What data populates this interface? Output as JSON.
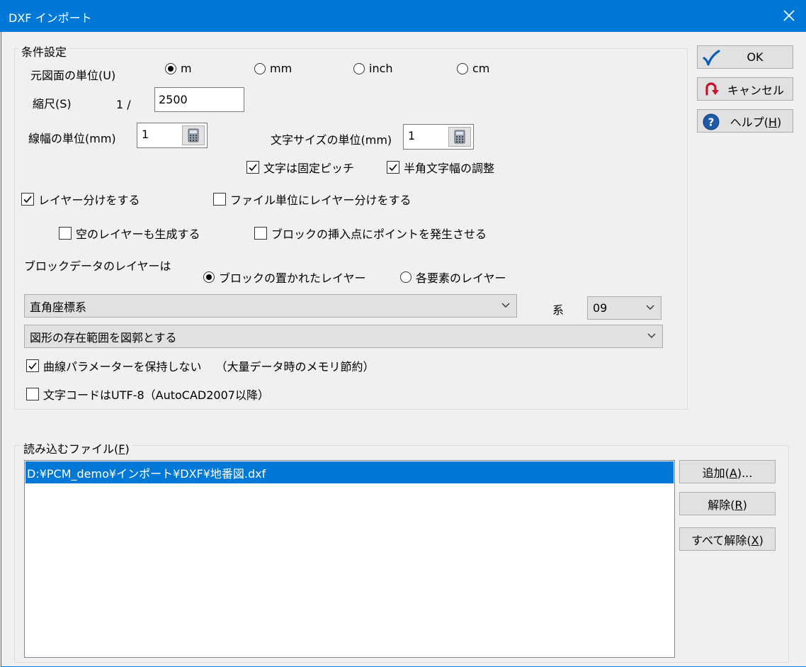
{
  "window": {
    "title": "DXF インポート"
  },
  "conditions": {
    "group_label": "条件設定",
    "unit_label": "元図面の単位(U)",
    "units": [
      {
        "label": "m",
        "selected": true
      },
      {
        "label": "mm",
        "selected": false
      },
      {
        "label": "inch",
        "selected": false
      },
      {
        "label": "cm",
        "selected": false
      }
    ],
    "scale_label": "縮尺(S)",
    "scale_prefix": "1 /",
    "scale_value": "2500",
    "line_width_label": "線幅の単位(mm)",
    "line_width_value": "1",
    "text_size_label": "文字サイズの単位(mm)",
    "text_size_value": "1",
    "fixed_pitch": {
      "label": "文字は固定ピッチ",
      "checked": true
    },
    "half_width_adjust": {
      "label": "半角文字幅の調整",
      "checked": true
    },
    "split_layers": {
      "label": "レイヤー分けをする",
      "checked": true
    },
    "split_by_file": {
      "label": "ファイル単位にレイヤー分けをする",
      "checked": false
    },
    "create_empty_layers": {
      "label": "空のレイヤーも生成する",
      "checked": false
    },
    "block_insert_points": {
      "label": "ブロックの挿入点にポイントを発生させる",
      "checked": false
    },
    "block_layer_label": "ブロックデータのレイヤーは",
    "block_layer_options": [
      {
        "label": "ブロックの置かれたレイヤー",
        "selected": true
      },
      {
        "label": "各要素のレイヤー",
        "selected": false
      }
    ],
    "coord_system": "直角座標系",
    "system_label": "系",
    "system_value": "09",
    "range_option": "図形の存在範囲を図郭とする",
    "no_curve_params": {
      "label": "曲線パラメーターを保持しない",
      "note": "（大量データ時のメモリ節約）",
      "checked": true
    },
    "utf8": {
      "label": "文字コードはUTF-8（AutoCAD2007以降）",
      "checked": false
    }
  },
  "buttons": {
    "ok": "OK",
    "cancel": "キャンセル",
    "help_text": "ヘルプ(",
    "help_key": "H",
    "help_end": ")"
  },
  "files": {
    "label_text": "読み込むファイル(",
    "label_key": "F",
    "label_end": ")",
    "items": [
      "D:¥PCM_demo¥インポート¥DXF¥地番図.dxf"
    ],
    "add_text": "追加(",
    "add_key": "A",
    "add_end": ")...",
    "remove_text": "解除(",
    "remove_key": "R",
    "remove_end": ")",
    "remove_all_text": "すべて解除(",
    "remove_all_key": "X",
    "remove_all_end": ")"
  },
  "colors": {
    "titlebar": "#0078d7",
    "selection": "#0078d7",
    "ok_check": "#0a5fb4",
    "cancel_arrow": "#c8102e",
    "help_icon": "#1e5aa8"
  }
}
